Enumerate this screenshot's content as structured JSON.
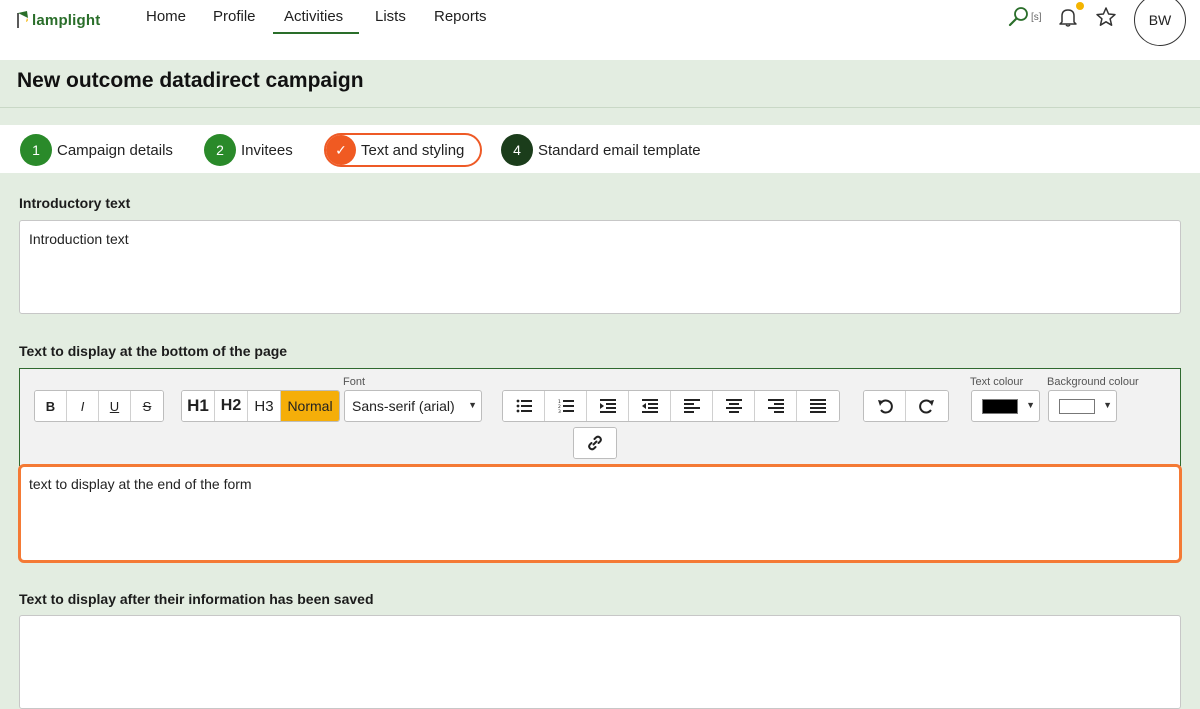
{
  "app": {
    "logo_text": "lamplight"
  },
  "nav": {
    "items": [
      {
        "label": "Home"
      },
      {
        "label": "Profile"
      },
      {
        "label": "Activities"
      },
      {
        "label": "Lists"
      },
      {
        "label": "Reports"
      }
    ],
    "search_hint": "[s]",
    "avatar": "BW"
  },
  "page": {
    "title": "New outcome datadirect campaign"
  },
  "steps": [
    {
      "num": "1",
      "label": "Campaign details"
    },
    {
      "num": "2",
      "label": "Invitees"
    },
    {
      "num": "✓",
      "label": "Text and styling"
    },
    {
      "num": "4",
      "label": "Standard email template"
    }
  ],
  "intro": {
    "label": "Introductory text",
    "value": "Introduction text"
  },
  "bottom": {
    "label": "Text to display at the bottom of the page",
    "value": "text to display at the end of the form"
  },
  "after": {
    "label": "Text to display after their information has been saved",
    "value": ""
  },
  "toolbar": {
    "bold": "B",
    "italic": "I",
    "underline": "U",
    "strike": "S",
    "h1": "H1",
    "h2": "H2",
    "h3": "H3",
    "normal": "Normal",
    "font_caption": "Font",
    "font_value": "Sans-serif (arial)",
    "text_colour_caption": "Text colour",
    "bg_colour_caption": "Background colour",
    "text_colour": "#000000",
    "bg_colour": "#ffffff"
  },
  "colors": {
    "accent": "#2a6e2a",
    "active_step": "#f05a22",
    "highlight": "#f5ae09"
  }
}
